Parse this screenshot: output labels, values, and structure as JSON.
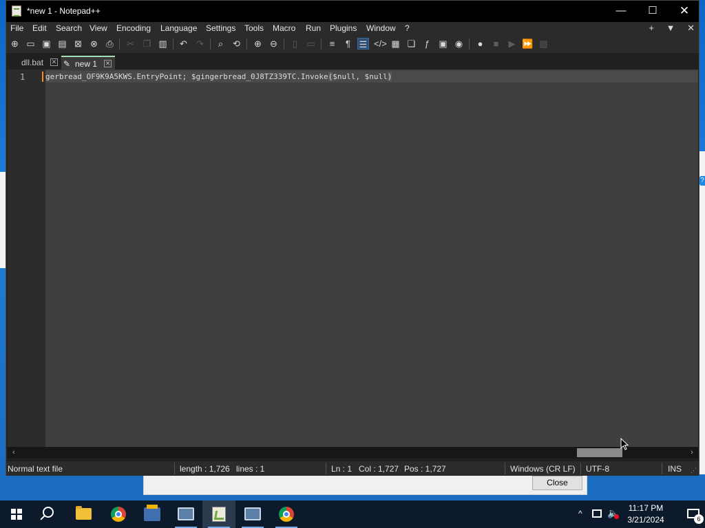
{
  "window": {
    "title": "*new 1 - Notepad++",
    "controls": {
      "minimize": "—",
      "maximize": "☐",
      "close": "✕"
    }
  },
  "menubar": {
    "items": [
      "File",
      "Edit",
      "Search",
      "View",
      "Encoding",
      "Language",
      "Settings",
      "Tools",
      "Macro",
      "Run",
      "Plugins",
      "Window",
      "?"
    ],
    "right": {
      "add": "+",
      "dropdown": "▼",
      "close": "✕"
    }
  },
  "toolbar": {
    "icons": [
      "new-file",
      "open",
      "save",
      "save-all",
      "close",
      "close-all",
      "print",
      "cut",
      "copy",
      "paste",
      "undo",
      "redo",
      "find",
      "replace",
      "zoom-in",
      "zoom-out",
      "sync-vertical",
      "sync-horizontal",
      "word-wrap",
      "show-all-chars",
      "indent-guide",
      "user-defined-language",
      "document-map",
      "document-list",
      "function-list",
      "folder-as-workspace",
      "monitoring",
      "record-macro",
      "stop-record",
      "play-macro",
      "run-macro-multiple",
      "save-macro"
    ]
  },
  "tabs": [
    {
      "label": "dll.bat",
      "active": false,
      "close": "✕"
    },
    {
      "label": "new 1",
      "active": true,
      "close": "✕"
    }
  ],
  "editor": {
    "line_number": "1",
    "code_before": "gerbread_OF9K9A5KWS.EntryPoint; $gingerbread_0J8TZ339TC.Invoke",
    "code_paren_open": "(",
    "code_args": "$null, $null",
    "code_paren_close": ")"
  },
  "scrollbar": {
    "left": "‹",
    "right": "›"
  },
  "statusbar": {
    "file_type": "Normal text file",
    "length": "length : 1,726",
    "lines": "lines : 1",
    "ln": "Ln : 1",
    "col": "Col : 1,727",
    "pos": "Pos : 1,727",
    "eol": "Windows (CR LF)",
    "encoding": "UTF-8",
    "mode": "INS"
  },
  "background_dialog": {
    "close_button": "Close"
  },
  "taskbar": {
    "clock_time": "11:17 PM",
    "clock_date": "3/21/2024",
    "notification_count": "6",
    "tray_chevron": "^"
  },
  "colors": {
    "accent": "#9fe0b4",
    "caret": "#ff8c1a",
    "editor_bg": "#3f3f3f"
  }
}
